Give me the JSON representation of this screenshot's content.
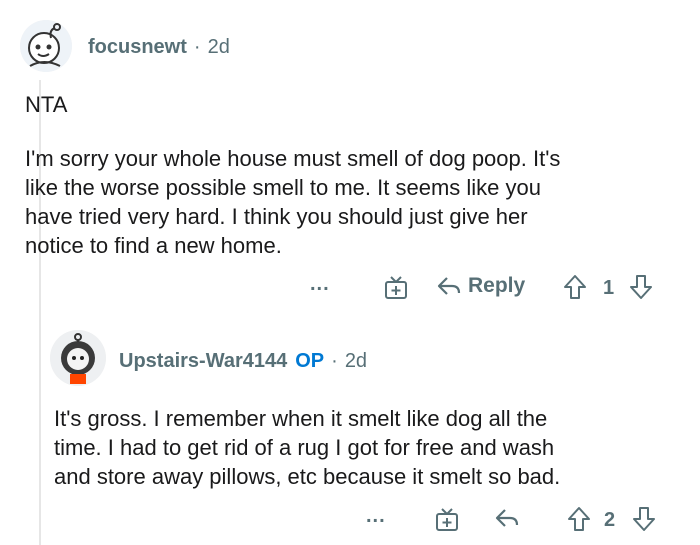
{
  "comments": [
    {
      "username": "focusnewt",
      "op_badge": "",
      "age": "2d",
      "lines": [
        "NTA"
      ],
      "paragraph": [
        "I'm sorry your whole house must smell of dog poop. It's",
        "like the worse possible smell to me. It seems like you",
        "have tried very hard. I think you should just give her",
        "notice to find a new home."
      ],
      "actions": {
        "more": "...",
        "reply_label": "Reply",
        "score": "1"
      }
    },
    {
      "username": "Upstairs-War4144",
      "op_badge": "OP",
      "age": "2d",
      "paragraph": [
        "It's gross. I remember when it smelt like dog all the",
        "time. I had to get rid of a rug I got for free and wash",
        "and store away pillows, etc because it smelt so bad."
      ],
      "actions": {
        "more": "...",
        "score": "2"
      }
    }
  ],
  "separator": "·",
  "colors": {
    "meta": "#576f76",
    "op": "#0079d3",
    "text": "#1a1a1b",
    "thread_line": "#e6e6e6"
  },
  "icons": [
    "snoo-avatar-icon",
    "award-icon",
    "reply-arrow-icon",
    "upvote-icon",
    "downvote-icon",
    "more-icon"
  ]
}
